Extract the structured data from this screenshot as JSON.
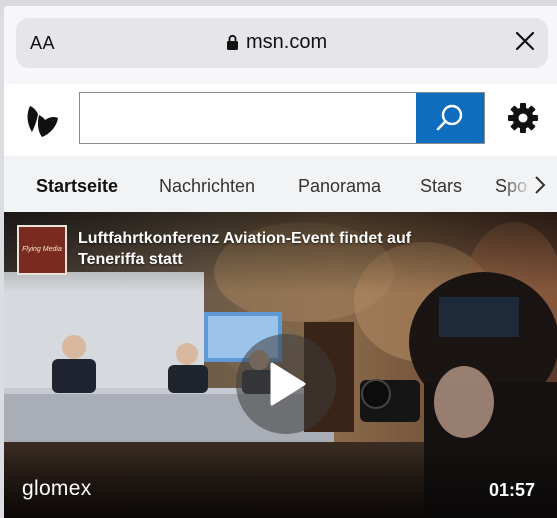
{
  "browser": {
    "text_size_label": "AA",
    "url": "msn.com"
  },
  "search": {
    "placeholder": "",
    "value": ""
  },
  "nav": {
    "tabs": [
      {
        "label": "Startseite",
        "active": true
      },
      {
        "label": "Nachrichten",
        "active": false
      },
      {
        "label": "Panorama",
        "active": false
      },
      {
        "label": "Stars",
        "active": false
      },
      {
        "label": "Spo",
        "active": false
      }
    ]
  },
  "video": {
    "title": "Luftfahrtkonferenz Aviation-Event findet auf Teneriffa statt",
    "channel_logo_text": "Flying Media",
    "brand": "glomex",
    "duration": "01:57"
  },
  "colors": {
    "search_button": "#0e6dbd",
    "nav_background": "#f2f3f5",
    "address_pill": "#e6e6ea"
  },
  "icons": {
    "lock": "lock-icon",
    "close": "close-icon",
    "msn_logo": "msn-butterfly-icon",
    "search": "search-icon",
    "settings": "gear-icon",
    "nav_next": "chevron-right-icon",
    "play": "play-icon"
  }
}
